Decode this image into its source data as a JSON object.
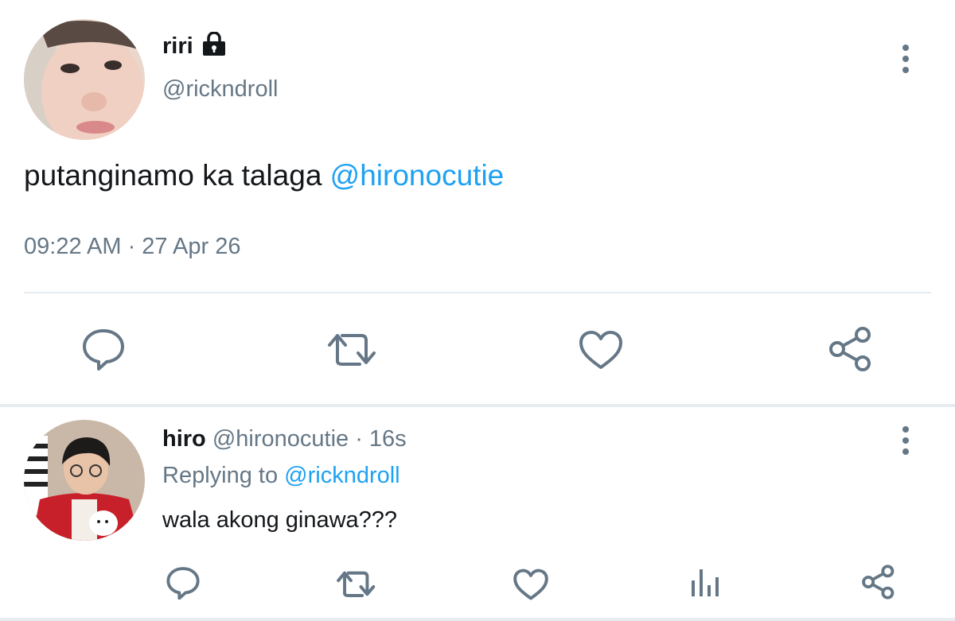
{
  "main_tweet": {
    "display_name": "riri",
    "handle": "@rickndroll",
    "text_plain": "putanginamo ka talaga ",
    "text_mention": "@hironocutie",
    "timestamp": "09:22 AM · 27 Apr 26",
    "actions": [
      "reply-icon",
      "retweet-icon",
      "like-icon",
      "share-icon"
    ]
  },
  "reply_tweet": {
    "display_name": "hiro",
    "meta": " @hironocutie · 16s",
    "replying_prefix": "Replying to ",
    "replying_mention": "@rickndroll",
    "text": "wala akong ginawa???",
    "actions": [
      "reply-icon",
      "retweet-icon",
      "like-icon",
      "analytics-icon",
      "share-icon"
    ]
  },
  "colors": {
    "accent": "#1da1f2",
    "muted": "#657786",
    "text": "#14171a",
    "divider": "#e6ecf0"
  }
}
